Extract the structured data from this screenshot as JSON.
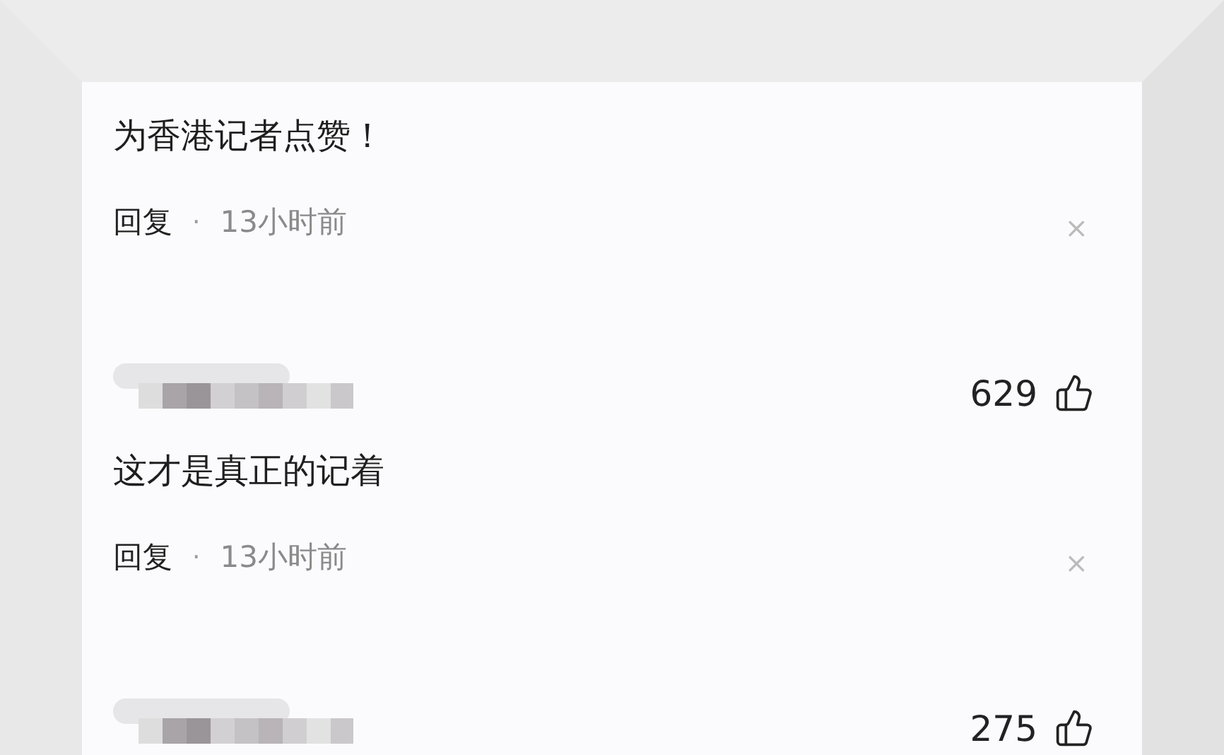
{
  "comments": [
    {
      "text": "为香港记者点赞！",
      "reply_label": "回复",
      "separator": "·",
      "time": "13小时前",
      "dismiss": "×"
    },
    {
      "author_hidden": true,
      "likes": "629",
      "text": "这才是真正的记着",
      "reply_label": "回复",
      "separator": "·",
      "time": "13小时前",
      "dismiss": "×"
    },
    {
      "author_hidden": true,
      "likes": "275"
    }
  ]
}
